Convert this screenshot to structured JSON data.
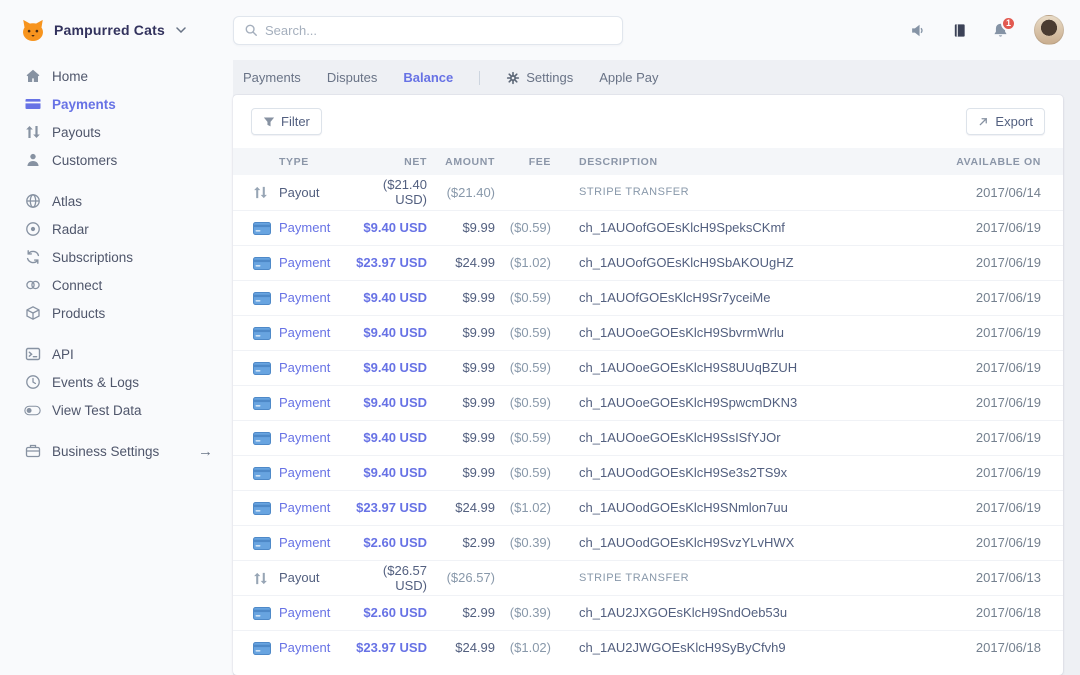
{
  "topbar": {
    "account_name": "Pampurred Cats",
    "search_placeholder": "Search...",
    "notification_count": "1"
  },
  "sidebar": {
    "main": [
      {
        "label": "Home"
      },
      {
        "label": "Payments"
      },
      {
        "label": "Payouts"
      },
      {
        "label": "Customers"
      }
    ],
    "products": [
      {
        "label": "Atlas"
      },
      {
        "label": "Radar"
      },
      {
        "label": "Subscriptions"
      },
      {
        "label": "Connect"
      },
      {
        "label": "Products"
      }
    ],
    "developer": [
      {
        "label": "API"
      },
      {
        "label": "Events & Logs"
      },
      {
        "label": "View Test Data"
      }
    ],
    "business_settings": {
      "label": "Business Settings"
    }
  },
  "tabs": {
    "payments": "Payments",
    "disputes": "Disputes",
    "balance": "Balance",
    "settings": "Settings",
    "apple_pay": "Apple Pay",
    "active": "Balance"
  },
  "toolbar": {
    "filter": "Filter",
    "export": "Export"
  },
  "table": {
    "headers": {
      "type": "TYPE",
      "net": "NET",
      "amount": "AMOUNT",
      "fee": "FEE",
      "description": "DESCRIPTION",
      "available_on": "AVAILABLE ON"
    },
    "rows": [
      {
        "kind": "payout",
        "type": "Payout",
        "net": "($21.40 USD)",
        "amount": "($21.40)",
        "fee": "",
        "description": "STRIPE TRANSFER",
        "available_on": "2017/06/14"
      },
      {
        "kind": "payment",
        "type": "Payment",
        "net": "$9.40 USD",
        "amount": "$9.99",
        "fee": "($0.59)",
        "description": "ch_1AUOofGOEsKlcH9SpeksCKmf",
        "available_on": "2017/06/19"
      },
      {
        "kind": "payment",
        "type": "Payment",
        "net": "$23.97 USD",
        "amount": "$24.99",
        "fee": "($1.02)",
        "description": "ch_1AUOofGOEsKlcH9SbAKOUgHZ",
        "available_on": "2017/06/19"
      },
      {
        "kind": "payment",
        "type": "Payment",
        "net": "$9.40 USD",
        "amount": "$9.99",
        "fee": "($0.59)",
        "description": "ch_1AUOfGOEsKlcH9Sr7yceiMe",
        "available_on": "2017/06/19"
      },
      {
        "kind": "payment",
        "type": "Payment",
        "net": "$9.40 USD",
        "amount": "$9.99",
        "fee": "($0.59)",
        "description": "ch_1AUOoeGOEsKlcH9SbvrmWrlu",
        "available_on": "2017/06/19"
      },
      {
        "kind": "payment",
        "type": "Payment",
        "net": "$9.40 USD",
        "amount": "$9.99",
        "fee": "($0.59)",
        "description": "ch_1AUOoeGOEsKlcH9S8UUqBZUH",
        "available_on": "2017/06/19"
      },
      {
        "kind": "payment",
        "type": "Payment",
        "net": "$9.40 USD",
        "amount": "$9.99",
        "fee": "($0.59)",
        "description": "ch_1AUOoeGOEsKlcH9SpwcmDKN3",
        "available_on": "2017/06/19"
      },
      {
        "kind": "payment",
        "type": "Payment",
        "net": "$9.40 USD",
        "amount": "$9.99",
        "fee": "($0.59)",
        "description": "ch_1AUOoeGOEsKlcH9SsISfYJOr",
        "available_on": "2017/06/19"
      },
      {
        "kind": "payment",
        "type": "Payment",
        "net": "$9.40 USD",
        "amount": "$9.99",
        "fee": "($0.59)",
        "description": "ch_1AUOodGOEsKlcH9Se3s2TS9x",
        "available_on": "2017/06/19"
      },
      {
        "kind": "payment",
        "type": "Payment",
        "net": "$23.97 USD",
        "amount": "$24.99",
        "fee": "($1.02)",
        "description": "ch_1AUOodGOEsKlcH9SNmlon7uu",
        "available_on": "2017/06/19"
      },
      {
        "kind": "payment",
        "type": "Payment",
        "net": "$2.60 USD",
        "amount": "$2.99",
        "fee": "($0.39)",
        "description": "ch_1AUOodGOEsKlcH9SvzYLvHWX",
        "available_on": "2017/06/19"
      },
      {
        "kind": "payout",
        "type": "Payout",
        "net": "($26.57 USD)",
        "amount": "($26.57)",
        "fee": "",
        "description": "STRIPE TRANSFER",
        "available_on": "2017/06/13"
      },
      {
        "kind": "payment",
        "type": "Payment",
        "net": "$2.60 USD",
        "amount": "$2.99",
        "fee": "($0.39)",
        "description": "ch_1AU2JXGOEsKlcH9SndOeb53u",
        "available_on": "2017/06/18"
      },
      {
        "kind": "payment",
        "type": "Payment",
        "net": "$23.97 USD",
        "amount": "$24.99",
        "fee": "($1.02)",
        "description": "ch_1AU2JWGOEsKlcH9SyByCfvh9",
        "available_on": "2017/06/18"
      }
    ]
  },
  "colors": {
    "accent_blue": "#6772e5",
    "notification_badge_red": "#e25950"
  }
}
